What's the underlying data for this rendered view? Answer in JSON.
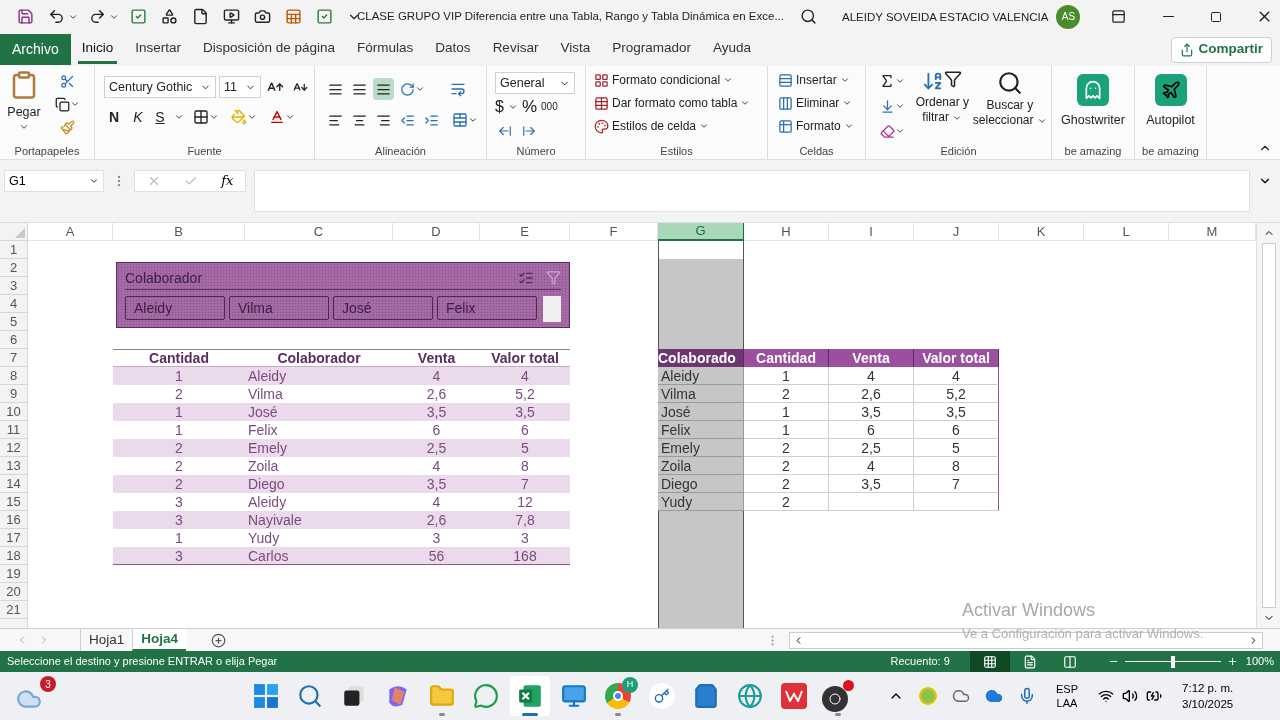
{
  "title_bar": {
    "title": "CLASE GRUPO VIP Diferencia entre una Tabla, Rango y Tabla Dinámica en Exce...",
    "user": "ALEIDY SOVEIDA ESTACIO VALENCIA",
    "avatar": "AS"
  },
  "ribbon_tabs": [
    {
      "label": "Archivo",
      "kind": "file",
      "selected": false
    },
    {
      "label": "Inicio",
      "kind": "tab",
      "selected": true
    },
    {
      "label": "Insertar",
      "kind": "tab",
      "selected": false
    },
    {
      "label": "Disposición de página",
      "kind": "tab",
      "selected": false
    },
    {
      "label": "Fórmulas",
      "kind": "tab",
      "selected": false
    },
    {
      "label": "Datos",
      "kind": "tab",
      "selected": false
    },
    {
      "label": "Revisar",
      "kind": "tab",
      "selected": false
    },
    {
      "label": "Vista",
      "kind": "tab",
      "selected": false
    },
    {
      "label": "Programador",
      "kind": "tab",
      "selected": false
    },
    {
      "label": "Ayuda",
      "kind": "tab",
      "selected": false
    }
  ],
  "share_button": "Compartir",
  "ribbon": {
    "clipboard": {
      "paste": "Pegar",
      "group": "Portapapeles"
    },
    "font": {
      "name": "Century Gothic",
      "size": "11",
      "bold": "N",
      "italic": "K",
      "underline": "S",
      "group": "Fuente"
    },
    "alignment": {
      "group": "Alineación"
    },
    "number": {
      "format": "General",
      "currency": "$",
      "percent": "%",
      "thousands": "000",
      "group": "Número"
    },
    "styles": {
      "items": [
        "Formato condicional",
        "Dar formato como tabla",
        "Estilos de celda"
      ],
      "group": "Estilos"
    },
    "cells": {
      "items": [
        "Insertar",
        "Eliminar",
        "Formato"
      ],
      "group": "Celdas"
    },
    "editing": {
      "sort": "Ordenar y filtrar",
      "find": "Buscar y seleccionar",
      "group": "Edición"
    },
    "addins": [
      {
        "label": "Ghostwriter",
        "kind": "ghost",
        "group": "be amazing"
      },
      {
        "label": "Autopilot",
        "kind": "plane",
        "group": "be amazing"
      }
    ]
  },
  "formula_bar": {
    "name_box": "G1",
    "function_label": "fx"
  },
  "sheet": {
    "column_headers": [
      {
        "label": "A",
        "selected": false
      },
      {
        "label": "B",
        "selected": false
      },
      {
        "label": "C",
        "selected": false
      },
      {
        "label": "D",
        "selected": false
      },
      {
        "label": "E",
        "selected": false
      },
      {
        "label": "F",
        "selected": false
      },
      {
        "label": "G",
        "selected": true
      },
      {
        "label": "H",
        "selected": false
      },
      {
        "label": "I",
        "selected": false
      },
      {
        "label": "J",
        "selected": false
      },
      {
        "label": "K",
        "selected": false
      },
      {
        "label": "L",
        "selected": false
      },
      {
        "label": "M",
        "selected": false
      }
    ],
    "row_headers": [
      "1",
      "2",
      "3",
      "4",
      "5",
      "6",
      "7",
      "8",
      "9",
      "10",
      "11",
      "12",
      "13",
      "14",
      "15",
      "16",
      "17",
      "18",
      "19",
      "20",
      "21"
    ],
    "slicer": {
      "title": "Colaborador",
      "buttons": [
        "Aleidy",
        "Vilma",
        "José",
        "Felix"
      ]
    },
    "left_table": {
      "columns": [
        "Cantidad",
        "Colaborador",
        "Venta",
        "Valor total"
      ],
      "rows": [
        [
          "1",
          "Aleidy",
          "4",
          "4"
        ],
        [
          "2",
          "Vilma",
          "2,6",
          "5,2"
        ],
        [
          "1",
          "José",
          "3,5",
          "3,5"
        ],
        [
          "1",
          "Felix",
          "6",
          "6"
        ],
        [
          "2",
          "Emely",
          "2,5",
          "5"
        ],
        [
          "2",
          "Zoila",
          "4",
          "8"
        ],
        [
          "2",
          "Diego",
          "3,5",
          "7"
        ],
        [
          "3",
          "Aleidy",
          "4",
          "12"
        ],
        [
          "3",
          "Nayivale",
          "2,6",
          "7,8"
        ],
        [
          "1",
          "Yudy",
          "3",
          "3"
        ],
        [
          "3",
          "Carlos",
          "56",
          "168"
        ]
      ]
    },
    "right_table": {
      "columns": [
        "Colaborado",
        "Cantidad",
        "Venta",
        "Valor total"
      ],
      "rows": [
        [
          "Aleidy",
          "1",
          "4",
          "4"
        ],
        [
          "Vilma",
          "2",
          "2,6",
          "5,2"
        ],
        [
          "José",
          "1",
          "3,5",
          "3,5"
        ],
        [
          "Felix",
          "1",
          "6",
          "6"
        ],
        [
          "Emely",
          "2",
          "2,5",
          "5"
        ],
        [
          "Zoila",
          "2",
          "4",
          "8"
        ],
        [
          "Diego",
          "2",
          "3,5",
          "7"
        ],
        [
          "Yudy",
          "2"
        ]
      ]
    }
  },
  "sheet_tabs": [
    {
      "label": "Hoja1",
      "selected": false
    },
    {
      "label": "Hoja4",
      "selected": true
    }
  ],
  "activation": {
    "title": "Activar Windows",
    "hint": "Ve a Configuración para activar Windows."
  },
  "status_bar": {
    "message": "Seleccione el destino y presione ENTRAR o elija Pegar",
    "count": "Recuento: 9",
    "views": [
      {
        "kind": "normal",
        "selected": true
      },
      {
        "kind": "layout",
        "selected": false
      },
      {
        "kind": "pagebreak",
        "selected": false
      }
    ],
    "zoom": {
      "level": 0.5,
      "reading": "100%"
    }
  },
  "taskbar": {
    "weather_badge": "3",
    "apps": [
      {
        "kind": "start",
        "running": false,
        "active": false
      },
      {
        "kind": "search",
        "running": false,
        "active": false
      },
      {
        "kind": "taskview",
        "running": false,
        "active": false
      },
      {
        "kind": "copilot",
        "running": false,
        "active": false
      },
      {
        "kind": "folder",
        "running": true,
        "active": false
      },
      {
        "kind": "chat",
        "running": false,
        "active": false
      },
      {
        "kind": "sheet",
        "running": true,
        "active": true
      },
      {
        "kind": "monitor",
        "running": false,
        "active": false
      },
      {
        "kind": "browser",
        "running": true,
        "active": false,
        "badge": "H"
      },
      {
        "kind": "key",
        "running": false,
        "active": false
      },
      {
        "kind": "store",
        "running": false,
        "active": false
      },
      {
        "kind": "globe",
        "running": false,
        "active": false
      },
      {
        "kind": "office",
        "running": false,
        "active": false
      },
      {
        "kind": "recorder",
        "running": true,
        "active": false
      }
    ],
    "language": "ESP",
    "region": "LAA",
    "time": "7:12 p. m.",
    "date": "3/10/2025"
  }
}
